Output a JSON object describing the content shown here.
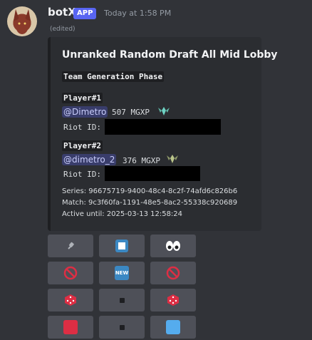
{
  "message": {
    "username": "botX",
    "badge": "APP",
    "timestamp": "Today at 1:58 PM",
    "edited": "(edited)"
  },
  "embed": {
    "title": "Unranked Random Draft All Mid Lobby",
    "phase": "Team Generation Phase",
    "players": [
      {
        "label": "Player#1",
        "mention": "@Dimetro",
        "mgxp": "507 MGXP",
        "riot_label": "Riot ID:",
        "rank_icon": "rank-emblem-icon"
      },
      {
        "label": "Player#2",
        "mention": "@dimetro_2",
        "mgxp": "376 MGXP",
        "riot_label": "Riot ID:",
        "rank_icon": "rank-emblem-icon"
      }
    ],
    "series": "Series: 96675719-9400-48c4-8c2f-74afd6c826b6",
    "match": "Match: 9c3f60fa-1191-48e5-8ac2-55338c920689",
    "active_until": "Active until: 2025-03-13 12:58:24"
  },
  "buttons": [
    [
      "plug-icon",
      "stop-icon",
      "eyes-icon"
    ],
    [
      "prohibited-icon",
      "new-icon",
      "prohibited-icon"
    ],
    [
      "die-icon",
      "small-square-icon",
      "die-icon"
    ],
    [
      "red-square-icon",
      "small-square-icon",
      "blue-square-icon"
    ]
  ],
  "button_glyphs": {
    "new": "NEW"
  },
  "colors": {
    "background": "#313338",
    "embed_background": "#2b2d31",
    "blurple": "#5865f2",
    "button": "#4e5058"
  }
}
